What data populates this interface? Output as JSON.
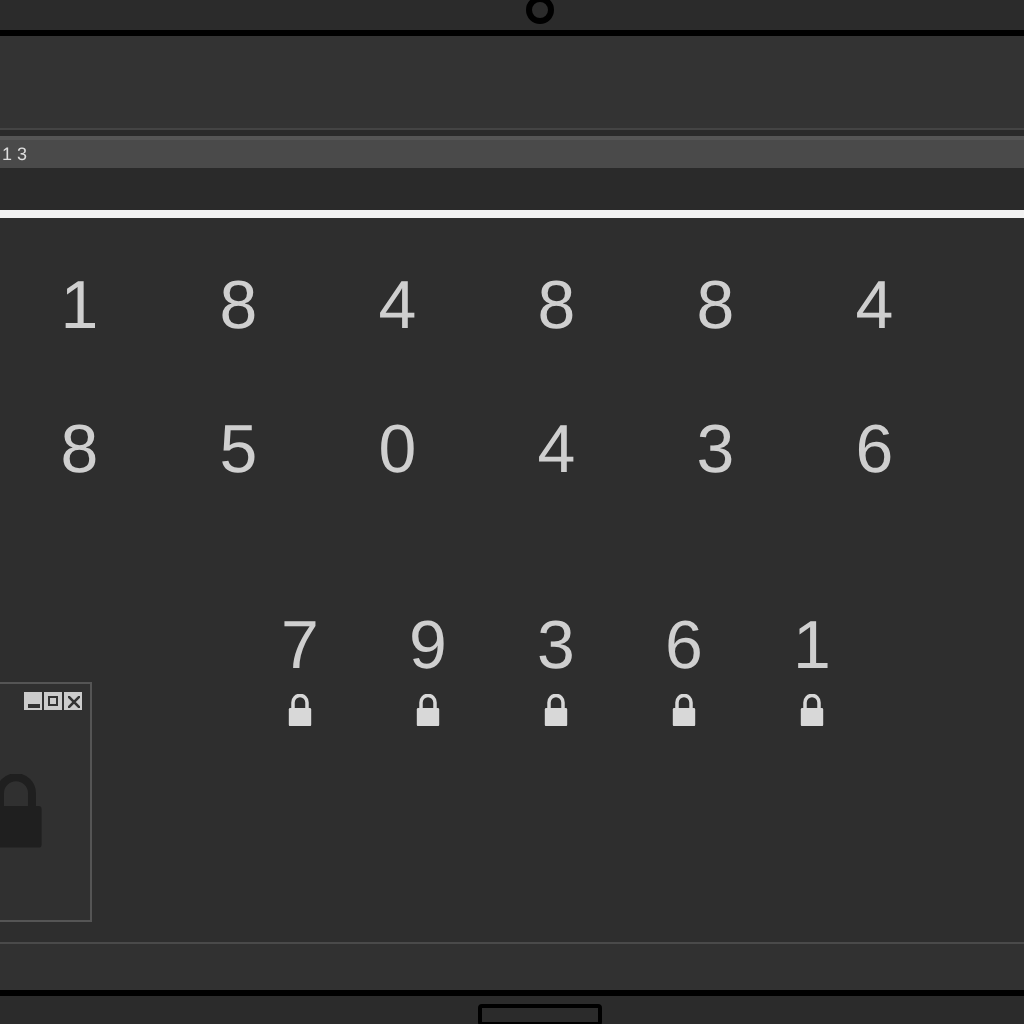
{
  "status_bar": {
    "text": "1 3"
  },
  "digit_rows": [
    {
      "digits": [
        "1",
        "8",
        "4",
        "8",
        "8",
        "4"
      ]
    },
    {
      "digits": [
        "8",
        "5",
        "0",
        "4",
        "3",
        "6"
      ]
    }
  ],
  "locked_digits": [
    {
      "digit": "7",
      "locked": true
    },
    {
      "digit": "9",
      "locked": true
    },
    {
      "digit": "3",
      "locked": true
    },
    {
      "digit": "6",
      "locked": true
    },
    {
      "digit": "1",
      "locked": true
    }
  ],
  "mini_window": {
    "locked": true
  }
}
